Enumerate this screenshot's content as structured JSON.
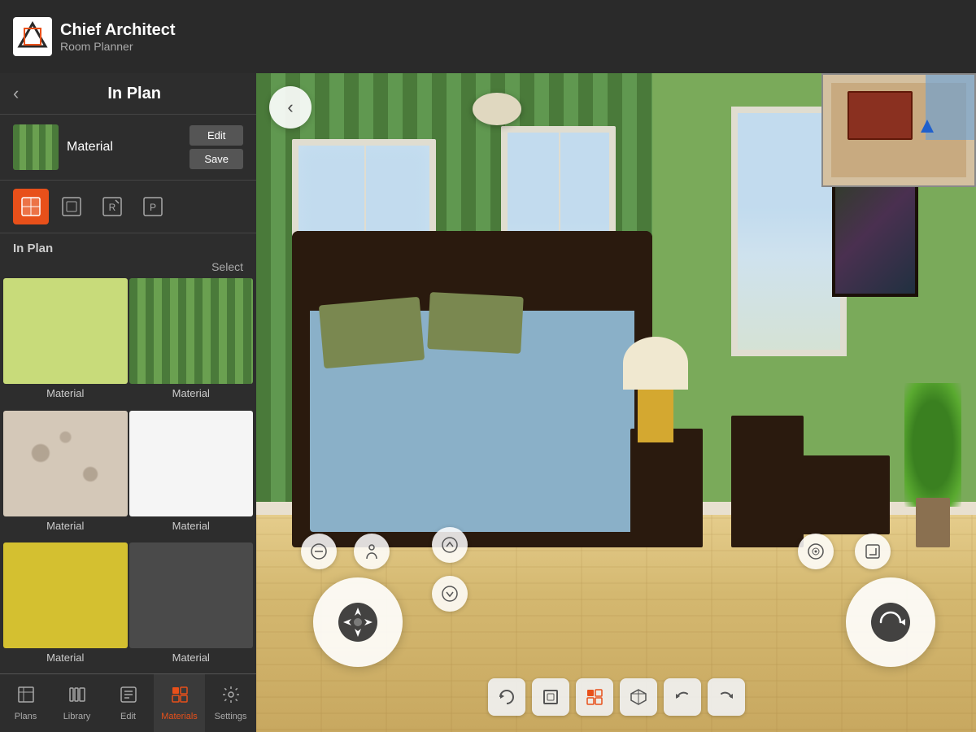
{
  "app": {
    "name": "Chief Architect",
    "subtitle": "Room Planner",
    "logo_char": "CA"
  },
  "header": {
    "back_label": "←",
    "title": "In Plan"
  },
  "material_preview": {
    "label": "Material",
    "edit_label": "Edit",
    "save_label": "Save"
  },
  "tool_icons": [
    {
      "name": "material-fill-icon",
      "char": "⊞",
      "active": true
    },
    {
      "name": "material-obj-icon",
      "char": "⊟",
      "active": false
    },
    {
      "name": "material-reset-icon",
      "char": "↺",
      "active": false
    },
    {
      "name": "material-paint-icon",
      "char": "⊡",
      "active": false
    }
  ],
  "section_label": "In Plan",
  "select_label": "Select",
  "materials": [
    {
      "name": "Material",
      "swatch": "green-solid"
    },
    {
      "name": "Material",
      "swatch": "green-stripe"
    },
    {
      "name": "Material",
      "swatch": "floral"
    },
    {
      "name": "Material",
      "swatch": "white"
    },
    {
      "name": "Material",
      "swatch": "yellow"
    },
    {
      "name": "Material",
      "swatch": "dark"
    }
  ],
  "nav": {
    "items": [
      {
        "label": "Plans",
        "icon": "🏠",
        "active": false
      },
      {
        "label": "Library",
        "icon": "📚",
        "active": false
      },
      {
        "label": "Edit",
        "icon": "✏️",
        "active": false
      },
      {
        "label": "Materials",
        "icon": "🎨",
        "active": true
      },
      {
        "label": "Settings",
        "icon": "⚙️",
        "active": false
      }
    ]
  },
  "view3d": {
    "back_label": "←"
  },
  "controls": {
    "move_icon": "✛",
    "rotate_icon": "↺",
    "measure_icon": "⊖",
    "person_icon": "🚶",
    "up_icon": "⌃",
    "down_icon": "⌄",
    "camera_icon": "◎",
    "resize_icon": "⤢"
  },
  "toolbar3d": {
    "buttons": [
      {
        "name": "refresh-btn",
        "char": "↺",
        "accent": false
      },
      {
        "name": "frame-btn",
        "char": "⬚",
        "accent": false
      },
      {
        "name": "grid-btn",
        "char": "⊞",
        "accent": true
      },
      {
        "name": "box-btn",
        "char": "⬡",
        "accent": false
      },
      {
        "name": "undo-btn",
        "char": "↩",
        "accent": false
      },
      {
        "name": "redo-btn",
        "char": "↪",
        "accent": false
      }
    ]
  }
}
